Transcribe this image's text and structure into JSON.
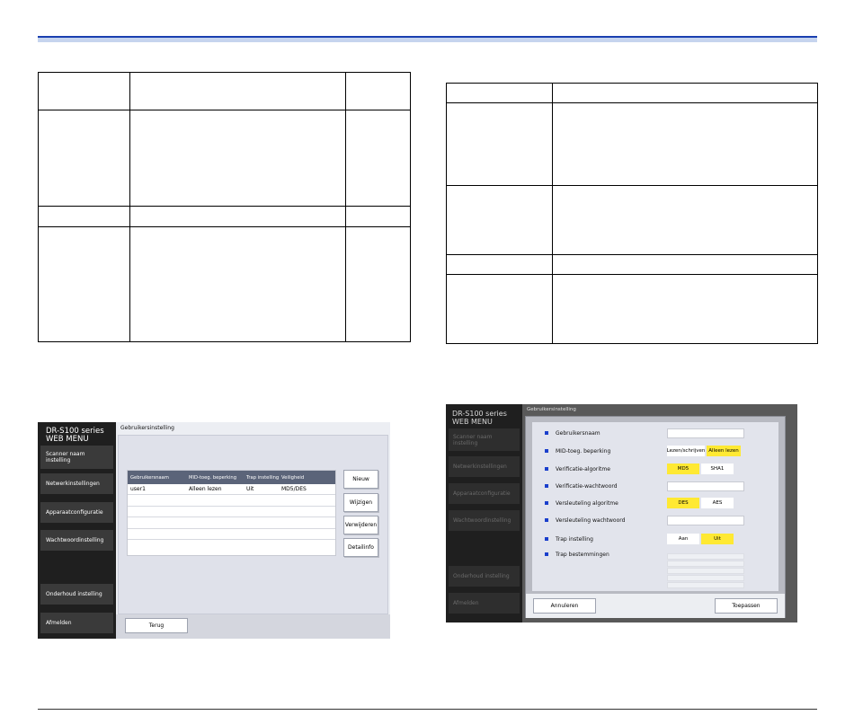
{
  "screen1": {
    "brand": "DR-S100 series\nWEB MENU",
    "sidebar": [
      "Scanner naam\ninstelling",
      "Netwerkinstellingen",
      "Apparaatconfiguratie",
      "Wachtwoordinstelling",
      "Onderhoud instelling",
      "Afmelden"
    ],
    "title": "Gebruikersinstelling",
    "table": {
      "headers": [
        "Gebruikersnaam",
        "MID-toeg. beperking",
        "Trap instelling",
        "Veiligheid"
      ],
      "rows": [
        [
          "user1",
          "Alleen lezen",
          "Uit",
          "MD5/DES"
        ]
      ]
    },
    "buttons": {
      "new": "Nieuw",
      "edit": "Wijzigen",
      "delete": "Verwijderen",
      "detail": "Detailinfo"
    },
    "back": "Terug"
  },
  "screen2": {
    "brand": "DR-S100 series\nWEB MENU",
    "sidebar": [
      "Scanner naam\ninstelling",
      "Netwerkinstellingen",
      "Apparaatconfiguratie",
      "Wachtwoordinstelling",
      "Onderhoud instelling",
      "Afmelden"
    ],
    "title": "Gebruikersinstelling",
    "fields": {
      "username": "Gebruikersnaam",
      "mib": "MID-toeg. beperking",
      "auth_alg": "Verificatie-algoritme",
      "auth_pw": "Verificatie-wachtwoord",
      "enc_alg": "Versleuteling algoritme",
      "enc_pw": "Versleuteling wachtwoord",
      "trap": "Trap instelling",
      "trap_dest": "Trap bestemmingen"
    },
    "options": {
      "mib_rw": "Lezen/schrijven",
      "mib_ro": "Alleen lezen",
      "md5": "MD5",
      "sha1": "SHA1",
      "des": "DES",
      "aes": "AES",
      "trap_on": "Aan",
      "trap_off": "Uit"
    },
    "buttons": {
      "cancel": "Annuleren",
      "apply": "Toepassen"
    }
  },
  "colors": {
    "accent_bar": "#1a3fb0",
    "selected_option": "#ffe933",
    "table_header": "#5b6479"
  }
}
